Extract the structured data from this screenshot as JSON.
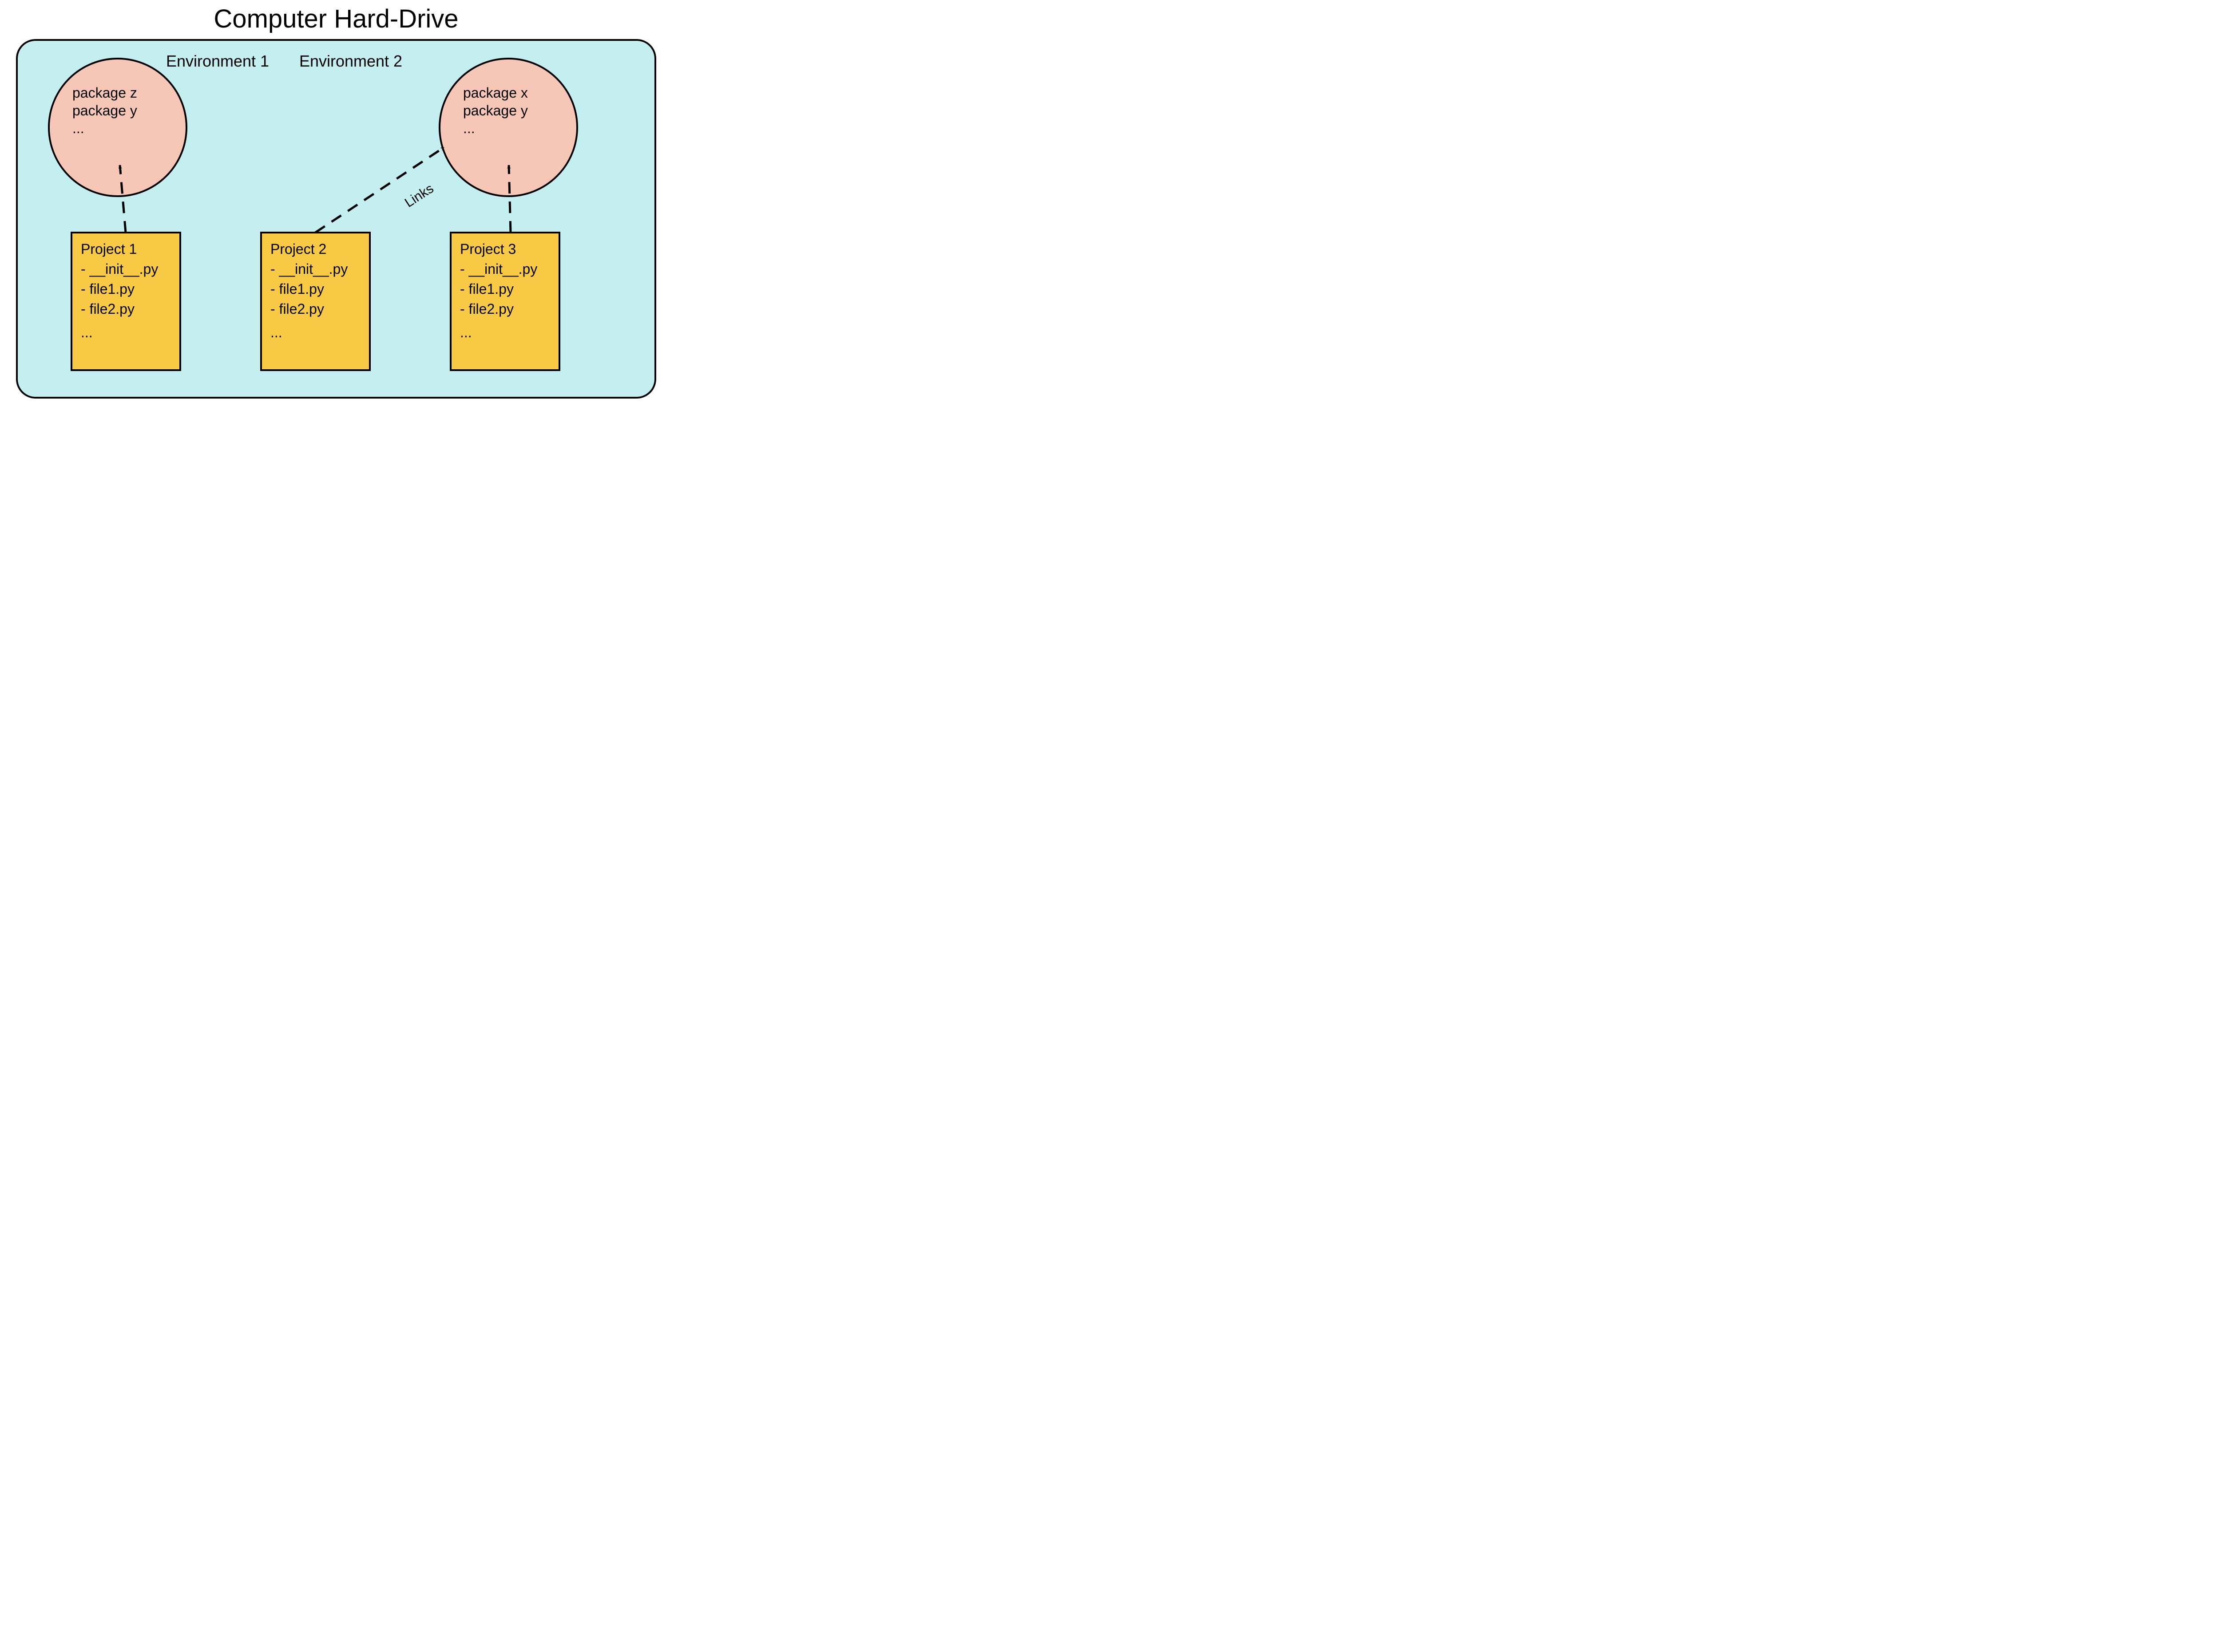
{
  "title": "Computer Hard-Drive",
  "environments": [
    {
      "label": "Environment 1",
      "packages": [
        "package z",
        "package y",
        "..."
      ]
    },
    {
      "label": "Environment 2",
      "packages": [
        "package x",
        "package y",
        "..."
      ]
    }
  ],
  "projects": [
    {
      "title": "Project 1",
      "files": [
        "- __init__.py",
        "- file1.py",
        "- file2.py",
        "..."
      ]
    },
    {
      "title": "Project 2",
      "files": [
        "- __init__.py",
        "- file1.py",
        "- file2.py",
        "..."
      ]
    },
    {
      "title": "Project 3",
      "files": [
        "- __init__.py",
        "- file1.py",
        "- file2.py",
        "..."
      ]
    }
  ],
  "links_label": "Links",
  "colors": {
    "container_fill": "#c4eef0",
    "circle_fill": "#f6c7b6",
    "project_fill": "#f7c944",
    "stroke": "#000000"
  }
}
